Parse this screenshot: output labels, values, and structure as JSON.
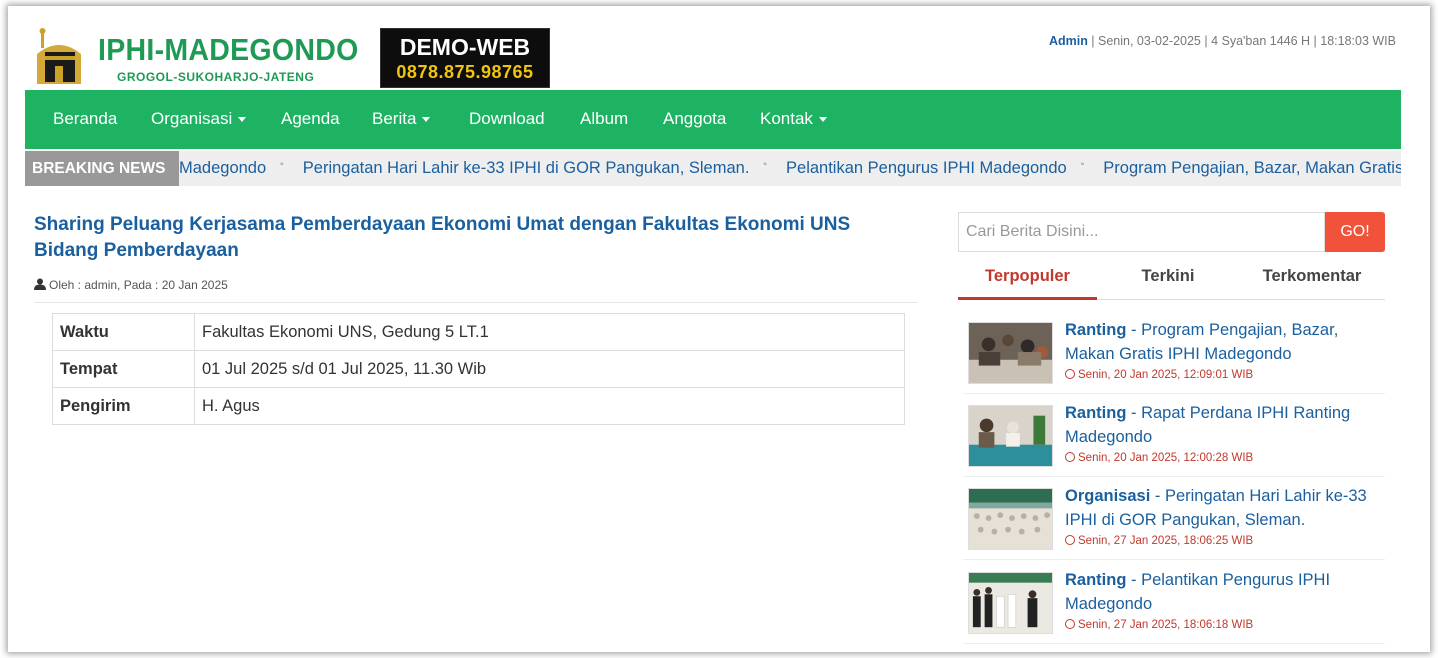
{
  "header": {
    "logo_title": "IPHI-MADEGONDO",
    "logo_subtitle": "GROGOL-SUKOHARJO-JATENG",
    "demo_title": "DEMO-WEB",
    "demo_phone": "0878.875.98765",
    "admin_label": "Admin",
    "date_info": " | Senin, 03-02-2025 | 4 Sya'ban 1446 H | 18:18:03 WIB"
  },
  "nav": {
    "items": [
      {
        "label": "Beranda",
        "dropdown": false
      },
      {
        "label": "Organisasi",
        "dropdown": true
      },
      {
        "label": "Agenda",
        "dropdown": false
      },
      {
        "label": "Berita",
        "dropdown": true
      },
      {
        "label": "Download",
        "dropdown": false
      },
      {
        "label": "Album",
        "dropdown": false
      },
      {
        "label": "Anggota",
        "dropdown": false
      },
      {
        "label": "Kontak",
        "dropdown": true
      }
    ]
  },
  "breaking": {
    "label": "BREAKING NEWS",
    "items": [
      "Madegondo",
      "Peringatan Hari Lahir ke-33 IPHI di GOR Pangukan, Sleman.",
      "Pelantikan Pengurus IPHI Madegondo",
      "Program Pengajian, Bazar, Makan Gratis IPHI Madegondo"
    ]
  },
  "article": {
    "title": "Sharing Peluang Kerjasama Pemberdayaan Ekonomi Umat dengan Fakultas Ekonomi UNS Bidang Pemberdayaan",
    "meta": "Oleh : admin, Pada : 20 Jan 2025",
    "rows": [
      {
        "key": "Waktu",
        "value": "Fakultas Ekonomi UNS, Gedung 5 LT.1"
      },
      {
        "key": "Tempat",
        "value": "01 Jul 2025 s/d 01 Jul 2025, 11.30 Wib"
      },
      {
        "key": "Pengirim",
        "value": "H. Agus"
      }
    ]
  },
  "sidebar": {
    "search_placeholder": "Cari Berita Disini...",
    "search_button": "GO!",
    "tabs": [
      "Terpopuler",
      "Terkini",
      "Terkomentar"
    ],
    "active_tab": "Terpopuler",
    "news": [
      {
        "category": "Ranting",
        "title": " - Program Pengajian, Bazar, Makan Gratis IPHI Madegondo",
        "date": "Senin, 20 Jan 2025, 12:09:01 WIB"
      },
      {
        "category": "Ranting",
        "title": " - Rapat Perdana IPHI Ranting Madegondo",
        "date": "Senin, 20 Jan 2025, 12:00:28 WIB"
      },
      {
        "category": "Organisasi",
        "title": " - Peringatan Hari Lahir ke-33 IPHI di GOR Pangukan, Sleman.",
        "date": "Senin, 27 Jan 2025, 18:06:25 WIB"
      },
      {
        "category": "Ranting",
        "title": " - Pelantikan Pengurus IPHI Madegondo",
        "date": "Senin, 27 Jan 2025, 18:06:18 WIB"
      }
    ]
  },
  "colors": {
    "nav_green": "#1db363",
    "link_blue": "#1a5f9e",
    "accent_red": "#c0392b",
    "button_orange": "#f0533a"
  }
}
